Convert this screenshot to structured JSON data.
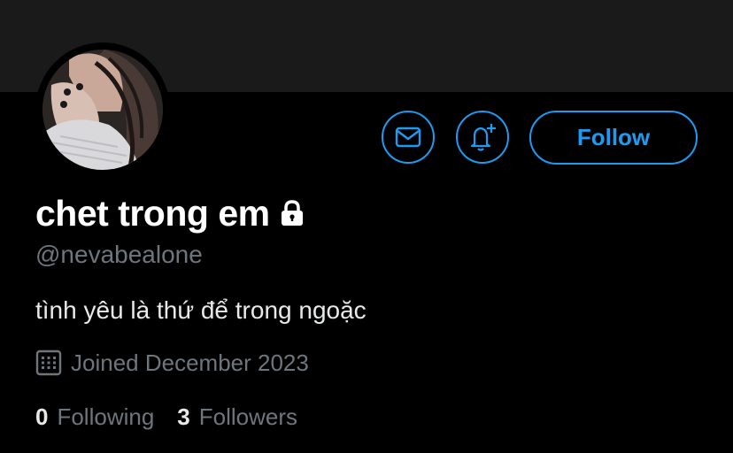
{
  "profile": {
    "display_name": "chet trong em",
    "handle": "@nevabealone",
    "bio": "tình yêu là thứ để trong ngoặc",
    "joined": "Joined December 2023",
    "protected_icon": "lock-icon",
    "avatar_description_icon": "profile-photo"
  },
  "actions": {
    "message_icon": "envelope-icon",
    "notify_icon": "bell-plus-icon",
    "follow_label": "Follow"
  },
  "stats": {
    "following_count": "0",
    "following_label": "Following",
    "followers_count": "3",
    "followers_label": "Followers"
  },
  "colors": {
    "background": "#000000",
    "banner": "#1a1a1b",
    "accent": "#1d9bf0",
    "primary_text": "#e7e9ea",
    "secondary_text": "#6e767d"
  }
}
